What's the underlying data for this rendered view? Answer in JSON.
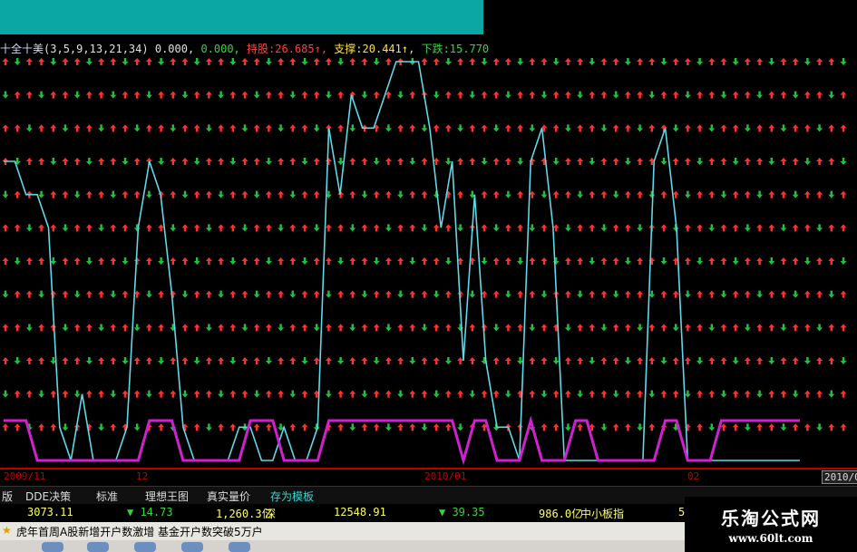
{
  "legend": {
    "name": "十全十美",
    "params": "(3,5,9,13,21,34)",
    "v1": "0.000,",
    "v2": "0.000,",
    "hold_label": "持股:",
    "hold_value": "26.685↑,",
    "support_label": "支撑:",
    "support_value": "20.441↑,",
    "drop_label": "下跌:",
    "drop_value": "15.770"
  },
  "colors": {
    "background": "#000000",
    "cyan_line": "#5fd8e8",
    "magenta_line": "#d020d0",
    "up_arrow": "#ff3030",
    "down_arrow": "#20c040",
    "axis": "#c00000",
    "topbar": "#0aa7a5"
  },
  "x_axis": {
    "labels": [
      "2009/11",
      "12",
      "2010/01",
      "02",
      "2010/0"
    ]
  },
  "tabs": [
    "版",
    "DDE决策",
    "标准",
    "理想王图",
    "真实量价",
    "存为模板"
  ],
  "quotes": {
    "q1": "3073.11",
    "q2": "▼ 14.73",
    "q3": "1,260.3亿",
    "q3b": "深",
    "q4": "12548.91",
    "q5": "▼ 39.35",
    "q6": "986.0亿",
    "q7": "中小板指",
    "q8": "5"
  },
  "news": {
    "star": "★",
    "text": "虎年首周A股新增开户数激增 基金开户数突破5万户"
  },
  "watermark": {
    "cn": "乐淘公式网",
    "url": "www.60lt.com"
  },
  "chart_data": {
    "type": "line",
    "series": [
      {
        "values": [
          9,
          9,
          8,
          8,
          7,
          1,
          0,
          2,
          0,
          0,
          0,
          1,
          7,
          9,
          8,
          5,
          1,
          0,
          0,
          0,
          0,
          1,
          1,
          0,
          0,
          1,
          0,
          0,
          1,
          10,
          8,
          11,
          10,
          10,
          11,
          12,
          12,
          12,
          10,
          7,
          9,
          3,
          8,
          3,
          1,
          1,
          0,
          9,
          10,
          7,
          0,
          0,
          0,
          0,
          0,
          0,
          0,
          0,
          9,
          10,
          7,
          0,
          0,
          0,
          0,
          0,
          0,
          0,
          0,
          0,
          0,
          0
        ]
      },
      {
        "values": [
          1,
          1,
          1,
          0,
          0,
          0,
          0,
          0,
          0,
          0,
          0,
          0,
          0,
          1,
          1,
          1,
          0,
          0,
          0,
          0,
          0,
          0,
          1,
          1,
          1,
          0,
          0,
          0,
          0,
          1,
          1,
          1,
          1,
          1,
          1,
          1,
          1,
          1,
          1,
          1,
          1,
          0,
          1,
          1,
          0,
          0,
          0,
          1,
          0,
          0,
          0,
          1,
          1,
          0,
          0,
          0,
          0,
          0,
          0,
          1,
          1,
          0,
          0,
          0,
          1,
          1,
          1,
          1,
          1,
          1,
          1,
          1
        ]
      }
    ]
  }
}
